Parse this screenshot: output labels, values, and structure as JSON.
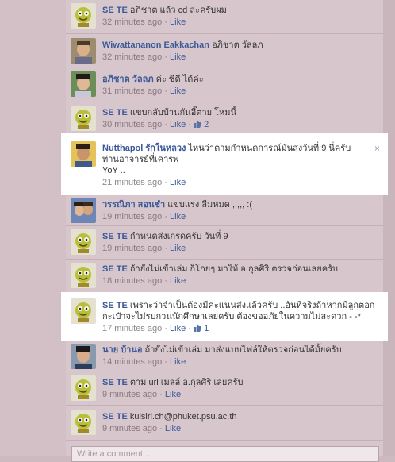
{
  "comments": [
    {
      "name": "SE TE",
      "text": "อภิชาต แล้ว cd ล่ะครับผม",
      "time": "32 minutes ago",
      "like": "Like",
      "avatar": "mascot-avatar"
    },
    {
      "name": "Wiwattananon Eakkachan",
      "text": "อภิชาต วัลลภ",
      "time": "32 minutes ago",
      "like": "Like",
      "avatar": "user-photo"
    },
    {
      "name": "อภิชาต วัลลภ",
      "text": "ค่ะ ซีดี ได้ค่ะ",
      "time": "31 minutes ago",
      "like": "Like",
      "avatar": "user-photo"
    },
    {
      "name": "SE TE",
      "text": "แขบกลับบ้านกันอี๊ตาย โหมนี้",
      "time": "30 minutes ago",
      "like": "Like",
      "likes": "2",
      "avatar": "mascot-avatar"
    },
    {
      "name": "Nutthapol รักในหลวง",
      "text": "ไหนว่าตามกำหนดการณ์มันส่งวันที่ 9 นี่ครับท่านอาจารย์ที่เคารพ",
      "text2": "YoY ..",
      "time": "21 minutes ago",
      "like": "Like",
      "avatar": "user-photo",
      "close": "×"
    },
    {
      "name": "วรรณิภา สอนชำ",
      "text": "แขบแรง ลืมหมด ,,,,, :(",
      "time": "19 minutes ago",
      "like": "Like",
      "avatar": "user-photo"
    },
    {
      "name": "SE TE",
      "text": "กำหนดส่งเกรดครับ วันที่ 9",
      "time": "19 minutes ago",
      "like": "Like",
      "avatar": "mascot-avatar"
    },
    {
      "name": "SE TE",
      "text": "ถ้ายังไม่เข้าเล่ม ก็โกยๆ มาให้ อ.กุลศิริ ตรวจก่อนเลยครับ",
      "time": "18 minutes ago",
      "like": "Like",
      "avatar": "mascot-avatar"
    },
    {
      "name": "SE TE",
      "text": "เพราะว่าจำเป็นต้องมีคะแนนส่งแล้วครับ ..อันที่จริงถ้าหากมีลูกตอกกะเป๋าจะไม่รบกวนนักศึกษาเลยครับ ต้องขออภัยในความไม่สะดวก - -*",
      "time": "17 minutes ago",
      "like": "Like",
      "likes": "1",
      "avatar": "mascot-avatar"
    },
    {
      "name": "นาย บ้านอ",
      "text": "ถ้ายังไม่เข้าเล่ม มาส่งแบบไฟล์ให้ตรวจก่อนได้มั้ยครับ",
      "time": "14 minutes ago",
      "like": "Like",
      "avatar": "user-photo"
    },
    {
      "name": "SE TE",
      "text": "ตาม url เมลล์ อ.กุลศิริ เลยครับ",
      "time": "9 minutes ago",
      "like": "Like",
      "avatar": "mascot-avatar"
    },
    {
      "name": "SE TE",
      "text": "kulsiri.ch@phuket.psu.ac.th",
      "time": "9 minutes ago",
      "like": "Like",
      "avatar": "mascot-avatar"
    }
  ],
  "write_placeholder": "Write a comment...",
  "sep": "·"
}
